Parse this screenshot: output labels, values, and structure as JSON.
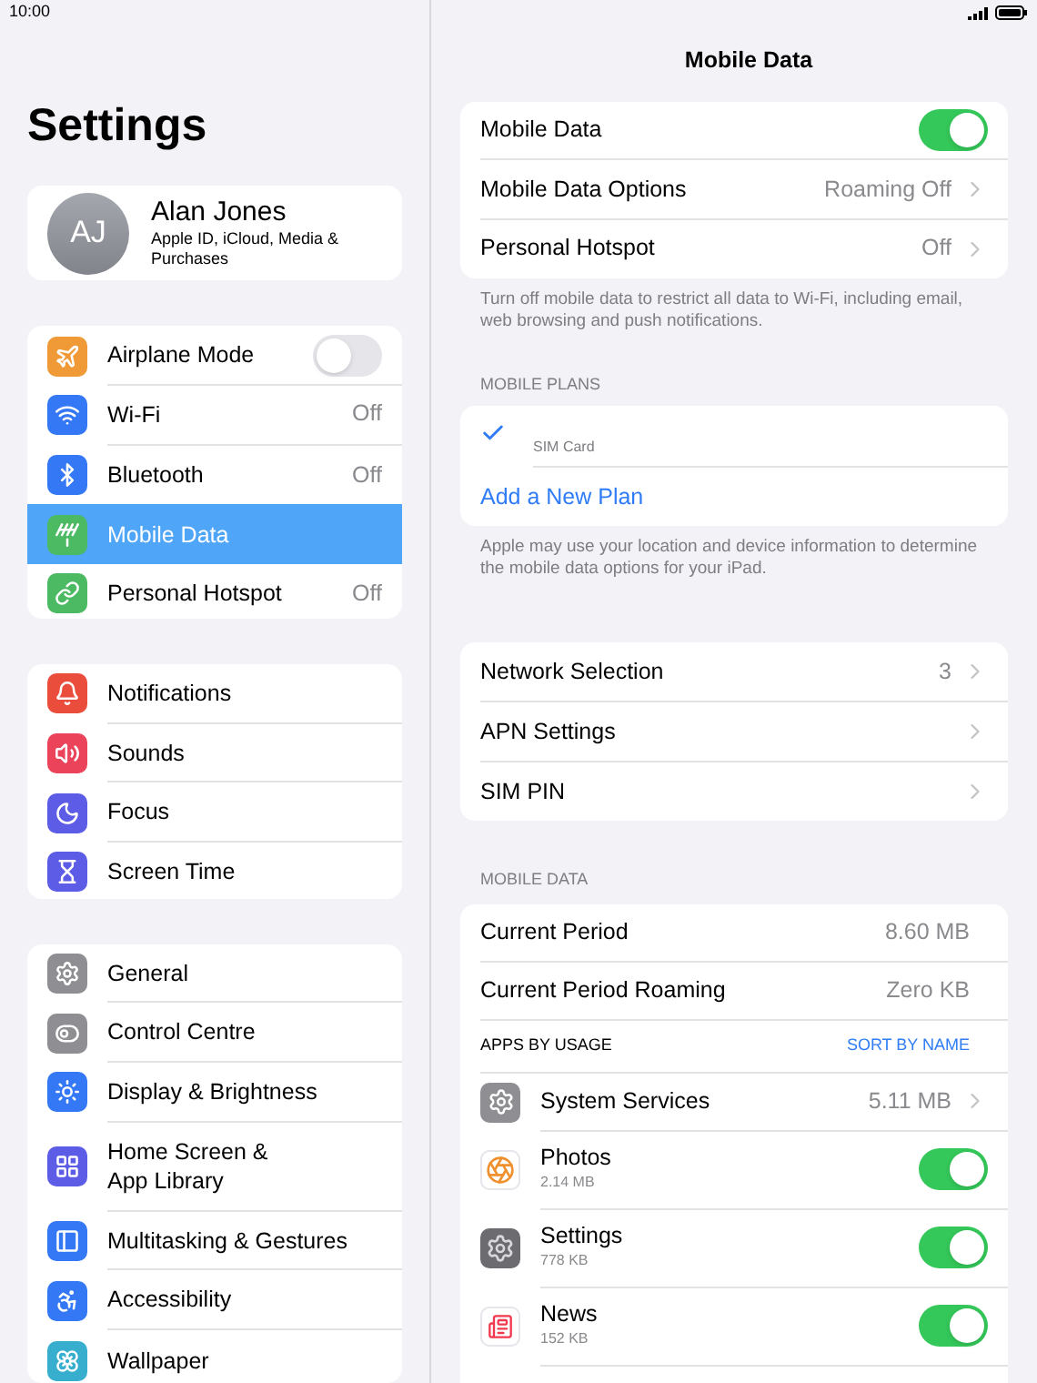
{
  "status_bar": {
    "time": "10:00"
  },
  "sidebar": {
    "title": "Settings",
    "profile": {
      "initials": "AJ",
      "name": "Alan Jones",
      "subtitle": "Apple ID, iCloud, Media & Purchases"
    },
    "groups": [
      [
        {
          "label": "Airplane Mode",
          "kind": "toggle",
          "on": false,
          "selected": false,
          "color": "#f09a37"
        },
        {
          "label": "Wi-Fi",
          "kind": "value",
          "value": "Off",
          "selected": false,
          "color": "#3478f6"
        },
        {
          "label": "Bluetooth",
          "kind": "value",
          "value": "Off",
          "selected": false,
          "color": "#3478f6"
        },
        {
          "label": "Mobile Data",
          "kind": "plain",
          "selected": true,
          "color": "#4cb963"
        },
        {
          "label": "Personal Hotspot",
          "kind": "value",
          "value": "Off",
          "selected": false,
          "color": "#4cb963"
        }
      ],
      [
        {
          "label": "Notifications",
          "kind": "plain",
          "selected": false,
          "color": "#eb4d3d"
        },
        {
          "label": "Sounds",
          "kind": "plain",
          "selected": false,
          "color": "#eb445a"
        },
        {
          "label": "Focus",
          "kind": "plain",
          "selected": false,
          "color": "#5d5ce6"
        },
        {
          "label": "Screen Time",
          "kind": "plain",
          "selected": false,
          "color": "#5d5ce6"
        }
      ],
      [
        {
          "label": "General",
          "kind": "plain",
          "selected": false,
          "color": "#8e8e93"
        },
        {
          "label": "Control Centre",
          "kind": "plain",
          "selected": false,
          "color": "#8e8e93"
        },
        {
          "label": "Display & Brightness",
          "kind": "plain",
          "selected": false,
          "color": "#3478f6"
        },
        {
          "label": "Home Screen &\nApp Library",
          "kind": "plain",
          "selected": false,
          "color": "#5d5ce6"
        },
        {
          "label": "Multitasking & Gestures",
          "kind": "plain",
          "selected": false,
          "color": "#3478f6"
        },
        {
          "label": "Accessibility",
          "kind": "plain",
          "selected": false,
          "color": "#3478f6"
        },
        {
          "label": "Wallpaper",
          "kind": "plain",
          "selected": false,
          "color": "#38aecf"
        }
      ]
    ]
  },
  "detail": {
    "title": "Mobile Data",
    "main_rows": [
      {
        "label": "Mobile Data",
        "kind": "toggle",
        "on": true
      },
      {
        "label": "Mobile Data Options",
        "kind": "link",
        "value": "Roaming Off"
      },
      {
        "label": "Personal Hotspot",
        "kind": "link",
        "value": "Off"
      }
    ],
    "main_footer": "Turn off mobile data to restrict all data to Wi-Fi, including email, web browsing and push notifications.",
    "plans_header": "MOBILE PLANS",
    "plans": [
      {
        "name": "SIM Card",
        "checked": true
      }
    ],
    "add_plan": "Add a New Plan",
    "plans_footer": "Apple may use your location and device information to determine the mobile data options for your iPad.",
    "network_rows": [
      {
        "label": "Network Selection",
        "kind": "link",
        "value": "3"
      },
      {
        "label": "APN Settings",
        "kind": "link"
      },
      {
        "label": "SIM PIN",
        "kind": "link"
      }
    ],
    "usage_header": "MOBILE DATA",
    "usage_rows": [
      {
        "label": "Current Period",
        "value": "8.60 MB"
      },
      {
        "label": "Current Period Roaming",
        "value": "Zero KB"
      }
    ],
    "apps_header": "APPS BY USAGE",
    "sort_link": "SORT BY NAME",
    "apps": [
      {
        "name": "System Services",
        "kind": "link",
        "value": "5.11 MB"
      },
      {
        "name": "Photos",
        "kind": "toggle",
        "size": "2.14 MB",
        "on": true
      },
      {
        "name": "Settings",
        "kind": "toggle",
        "size": "778 KB",
        "on": true
      },
      {
        "name": "News",
        "kind": "toggle",
        "size": "152 KB",
        "on": true
      }
    ]
  }
}
